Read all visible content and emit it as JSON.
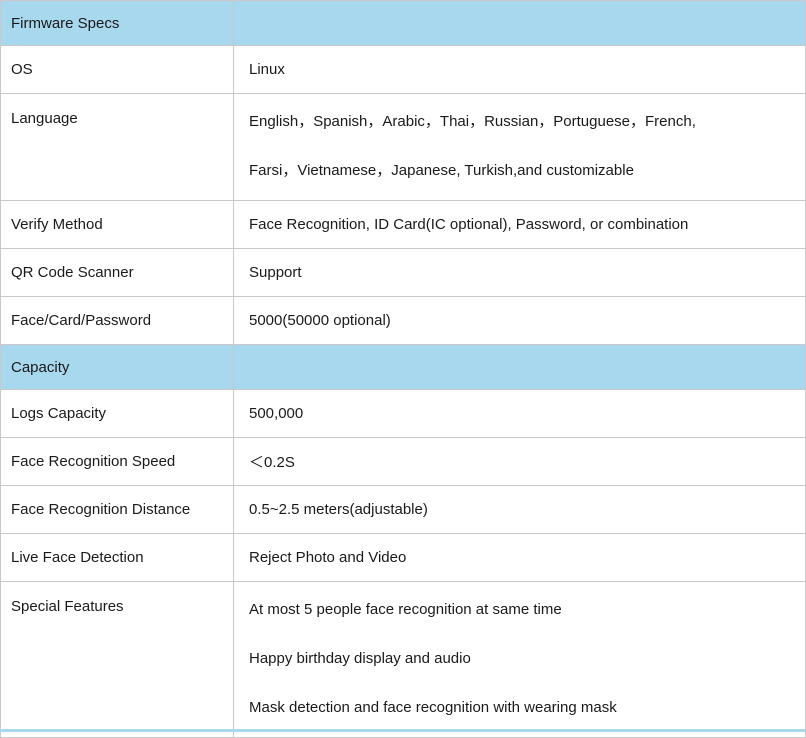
{
  "sections": {
    "firmware": {
      "title": "Firmware Specs",
      "rows": [
        {
          "label": "OS",
          "value": "Linux"
        },
        {
          "label": "Verify Method",
          "value": "Face Recognition, ID Card(IC optional), Password, or combination"
        },
        {
          "label": "QR Code Scanner",
          "value": "Support"
        },
        {
          "label": "Face/Card/Password",
          "value": "5000(50000 optional)"
        }
      ],
      "language": {
        "label": "Language",
        "lines": [
          "English，Spanish，Arabic，Thai，Russian，Portuguese，French,",
          "Farsi，Vietnamese，Japanese, Turkish,and customizable"
        ]
      }
    },
    "capacity": {
      "title": "Capacity",
      "rows": [
        {
          "label": "Logs Capacity",
          "value": "500,000"
        },
        {
          "label": "Face Recognition Speed",
          "value": "＜0.2S"
        },
        {
          "label": "Face Recognition Distance",
          "value": "0.5~2.5 meters(adjustable)"
        },
        {
          "label": "Live Face Detection",
          "value": "Reject Photo and Video"
        }
      ],
      "special": {
        "label": "Special Features",
        "lines": [
          "At most 5 people face recognition at same time",
          "Happy birthday display and audio",
          "Mask detection and face recognition with wearing mask"
        ]
      }
    }
  },
  "colors": {
    "section_header_bg": "#a8d8ee",
    "border": "#c9c9c9",
    "text": "#1a1a1a"
  }
}
